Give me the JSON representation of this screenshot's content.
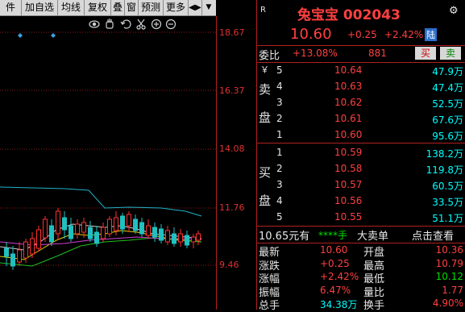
{
  "toolbar": {
    "items": [
      "件",
      "加自选",
      "均线",
      "复权",
      "叠",
      "窗",
      "预测",
      "更多"
    ],
    "more_arrow": "▼",
    "panel_toggle": "◀▶"
  },
  "chart_tools": {
    "icons": [
      "eye-icon",
      "hand-icon",
      "undo-icon",
      "scissors-icon",
      "zoom-in-icon",
      "zoom-out-icon"
    ]
  },
  "chart": {
    "price_labels": [
      "18.67",
      "16.37",
      "14.08",
      "11.76",
      "9.46"
    ]
  },
  "quote": {
    "r_label": "R",
    "name_code": "兔宝宝 002043",
    "price": "10.60",
    "change": "+0.25",
    "change_pct": "+2.42%",
    "market_badge": "陆",
    "weibi_label": "委比",
    "weibi_value": "+13.08%",
    "weicha_value": "881",
    "buy_btn": "买",
    "sell_btn": "卖",
    "sell_side_label": [
      "卖",
      "盘"
    ],
    "buy_side_label": [
      "买",
      "盘"
    ],
    "currency": "￥",
    "asks": [
      {
        "level": "5",
        "price": "10.64",
        "volume": "47.9万"
      },
      {
        "level": "4",
        "price": "10.63",
        "volume": "47.4万"
      },
      {
        "level": "3",
        "price": "10.62",
        "volume": "52.5万"
      },
      {
        "level": "2",
        "price": "10.61",
        "volume": "67.6万"
      },
      {
        "level": "1",
        "price": "10.60",
        "volume": "95.6万"
      }
    ],
    "bids": [
      {
        "level": "1",
        "price": "10.59",
        "volume": "138.2万"
      },
      {
        "level": "2",
        "price": "10.58",
        "volume": "119.8万"
      },
      {
        "level": "3",
        "price": "10.57",
        "volume": "60.5万"
      },
      {
        "level": "4",
        "price": "10.56",
        "volume": "33.5万"
      },
      {
        "level": "5",
        "price": "10.55",
        "volume": "51.1万"
      }
    ],
    "ad_price": "10.65元有",
    "ad_stars": "****手",
    "ad_big": "大卖单",
    "ad_link": "点击查看",
    "stats": [
      {
        "l1": "最新",
        "v1": "10.60",
        "l2": "开盘",
        "v2": "10.36"
      },
      {
        "l1": "涨跌",
        "v1": "+0.25",
        "l2": "最高",
        "v2": "10.79"
      },
      {
        "l1": "涨幅",
        "v1": "+2.42%",
        "l2": "最低",
        "v2": "10.12"
      },
      {
        "l1": "振幅",
        "v1": "6.47%",
        "l2": "量比",
        "v2": "1.77"
      },
      {
        "l1": "总手",
        "v1": "34.38万",
        "l2": "换手",
        "v2": "4.90%"
      }
    ]
  },
  "colors": {
    "up": "#ff4040",
    "down": "#00e000",
    "bg": "#000000",
    "grid": "#b02020"
  }
}
